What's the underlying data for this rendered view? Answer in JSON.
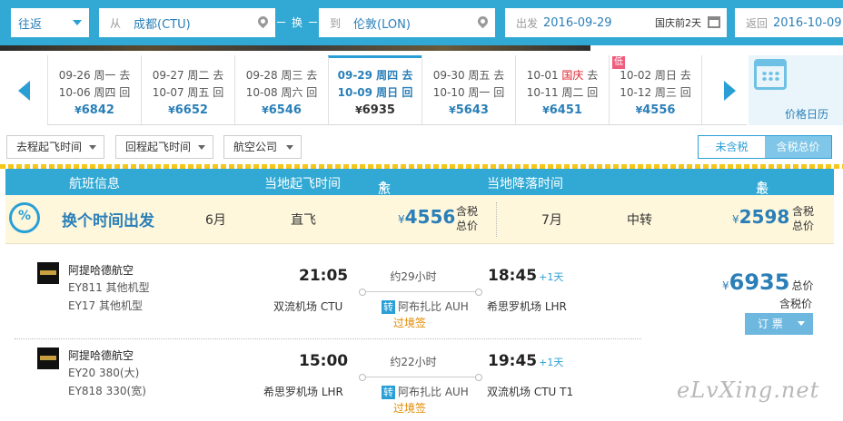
{
  "search": {
    "trip_type": "往返",
    "from_prefix": "从",
    "from_city": "成都(CTU)",
    "swap_label": "换",
    "to_prefix": "到",
    "to_city": "伦敦(LON)",
    "depart_prefix": "出发",
    "depart_date": "2016-09-29",
    "depart_holiday": "国庆前2天",
    "return_prefix": "返回",
    "return_date": "2016-10-09"
  },
  "dates": [
    {
      "go": "09-26 周一 去",
      "back": "10-06 周四 回",
      "price": "6842"
    },
    {
      "go": "09-27 周二 去",
      "back": "10-07 周五 回",
      "price": "6652"
    },
    {
      "go": "09-28 周三 去",
      "back": "10-08 周六 回",
      "price": "6546"
    },
    {
      "go": "09-29 周四 去",
      "back": "10-09 周日 回",
      "price": "6935"
    },
    {
      "go": "09-30 周五 去",
      "back": "10-10 周一 回",
      "price": "5643"
    },
    {
      "go_date": "10-01",
      "go_holiday": "国庆",
      "go_suffix": "去",
      "back": "10-11 周二 回",
      "price": "6451"
    },
    {
      "go": "10-02 周日 去",
      "back": "10-12 周三 回",
      "price": "4556",
      "low_tag": "低"
    }
  ],
  "currency": "¥",
  "calendar_label": "价格日历",
  "filters": {
    "depart_time": "去程起飞时间",
    "return_time": "回程起飞时间",
    "airline": "航空公司",
    "tax_off": "未含税",
    "tax_on": "含税总价"
  },
  "table_header": {
    "flight_info": "航班信息",
    "depart_time": "当地起飞时间",
    "duration": "旅行总时长",
    "arrive_time": "当地降落时间",
    "lowest_total": "最低总价"
  },
  "promo": {
    "title": "换个时间出发",
    "month1": "6月",
    "type1": "直飞",
    "price1": "4556",
    "month2": "7月",
    "type2": "中转",
    "price2": "2598",
    "tax_line1": "含税",
    "tax_line2": "总价"
  },
  "flights": [
    {
      "airline": "阿提哈德航空",
      "seg1": "EY811 其他机型",
      "seg2": "EY17 其他机型",
      "dep_time": "21:05",
      "duration": "约29小时",
      "arr_time": "18:45",
      "arr_plus": "+1天",
      "dep_airport": "双流机场 CTU",
      "transfer_badge": "转",
      "transfer_airport": "阿布扎比 AUH",
      "arr_airport": "希思罗机场 LHR",
      "visa": "过境签"
    },
    {
      "airline": "阿提哈德航空",
      "seg1": "EY20 380(大)",
      "seg2": "EY818 330(宽)",
      "dep_time": "15:00",
      "duration": "约22小时",
      "arr_time": "19:45",
      "arr_plus": "+1天",
      "dep_airport": "希思罗机场 LHR",
      "transfer_badge": "转",
      "transfer_airport": "阿布扎比 AUH",
      "arr_airport": "双流机场 CTU T1",
      "visa": "过境签"
    }
  ],
  "offer": {
    "price": "6935",
    "total_label": "总价",
    "tax_note": "含税价",
    "book_label": "订  票"
  },
  "watermark": "eLvXing.net",
  "colors": {
    "accent": "#31a9d4",
    "link": "#2a7fb8",
    "holiday": "#e0202a",
    "visa": "#e08a00"
  }
}
